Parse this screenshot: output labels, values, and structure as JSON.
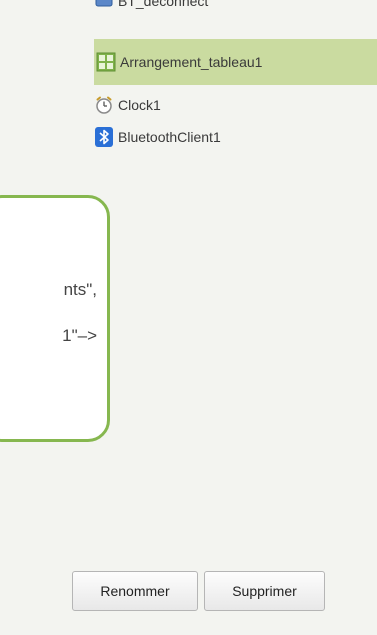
{
  "components": {
    "items": [
      {
        "label": "BT_deconnect",
        "icon": "bluetooth-button-icon"
      },
      {
        "label": "Arrangement_tableau1",
        "icon": "table-arrangement-icon",
        "selected": true
      },
      {
        "label": "Clock1",
        "icon": "clock-icon"
      },
      {
        "label": "BluetoothClient1",
        "icon": "bluetooth-icon"
      }
    ]
  },
  "callout": {
    "line1": "nts\",",
    "line2": "1\"–>"
  },
  "actions": {
    "rename_label": "Renommer",
    "delete_label": "Supprimer"
  },
  "colors": {
    "selected_bg": "#cadba0",
    "callout_border": "#86b74f",
    "panel_bg": "#f3f4f0"
  }
}
